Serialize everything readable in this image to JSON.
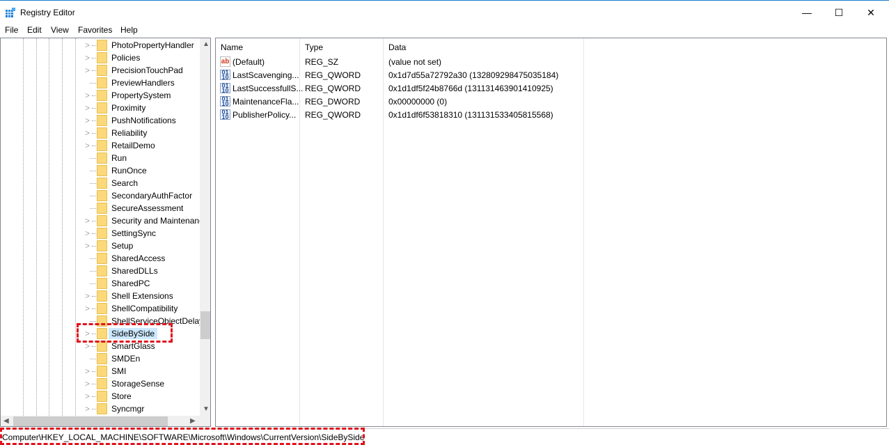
{
  "window": {
    "title": "Registry Editor",
    "minimize": "—",
    "maximize": "☐",
    "close": "✕"
  },
  "menu": [
    "File",
    "Edit",
    "View",
    "Favorites",
    "Help"
  ],
  "tree": [
    {
      "label": "PhotoPropertyHandler",
      "expandable": true
    },
    {
      "label": "Policies",
      "expandable": true
    },
    {
      "label": "PrecisionTouchPad",
      "expandable": true
    },
    {
      "label": "PreviewHandlers",
      "expandable": false
    },
    {
      "label": "PropertySystem",
      "expandable": true
    },
    {
      "label": "Proximity",
      "expandable": true
    },
    {
      "label": "PushNotifications",
      "expandable": true
    },
    {
      "label": "Reliability",
      "expandable": true
    },
    {
      "label": "RetailDemo",
      "expandable": true
    },
    {
      "label": "Run",
      "expandable": false
    },
    {
      "label": "RunOnce",
      "expandable": false
    },
    {
      "label": "Search",
      "expandable": false
    },
    {
      "label": "SecondaryAuthFactor",
      "expandable": false
    },
    {
      "label": "SecureAssessment",
      "expandable": false
    },
    {
      "label": "Security and Maintenance",
      "expandable": true
    },
    {
      "label": "SettingSync",
      "expandable": true
    },
    {
      "label": "Setup",
      "expandable": true
    },
    {
      "label": "SharedAccess",
      "expandable": false
    },
    {
      "label": "SharedDLLs",
      "expandable": false
    },
    {
      "label": "SharedPC",
      "expandable": false
    },
    {
      "label": "Shell Extensions",
      "expandable": true
    },
    {
      "label": "ShellCompatibility",
      "expandable": true
    },
    {
      "label": "ShellServiceObjectDelay",
      "expandable": false
    },
    {
      "label": "SideBySide",
      "expandable": true,
      "selected": true
    },
    {
      "label": "SmartGlass",
      "expandable": true
    },
    {
      "label": "SMDEn",
      "expandable": false
    },
    {
      "label": "SMI",
      "expandable": true
    },
    {
      "label": "StorageSense",
      "expandable": true
    },
    {
      "label": "Store",
      "expandable": true
    },
    {
      "label": "Syncmgr",
      "expandable": true
    }
  ],
  "columns": {
    "name": "Name",
    "type": "Type",
    "data": "Data"
  },
  "values": [
    {
      "icon": "string-value-icon",
      "name": "(Default)",
      "type": "REG_SZ",
      "data": "(value not set)"
    },
    {
      "icon": "binary-value-icon",
      "name": "LastScavenging...",
      "type": "REG_QWORD",
      "data": "0x1d7d55a72792a30 (132809298475035184)"
    },
    {
      "icon": "binary-value-icon",
      "name": "LastSuccessfullS...",
      "type": "REG_QWORD",
      "data": "0x1d1df5f24b8766d (131131463901410925)"
    },
    {
      "icon": "binary-value-icon",
      "name": "MaintenanceFla...",
      "type": "REG_DWORD",
      "data": "0x00000000 (0)"
    },
    {
      "icon": "binary-value-icon",
      "name": "PublisherPolicy...",
      "type": "REG_QWORD",
      "data": "0x1d1df6f53818310 (131131533405815568)"
    }
  ],
  "status": {
    "path": "Computer\\HKEY_LOCAL_MACHINE\\SOFTWARE\\Microsoft\\Windows\\CurrentVersion\\SideBySide"
  },
  "colors": {
    "highlight": "#cce8ff",
    "annotation": "#e0141e",
    "folder": "#fbd97b"
  }
}
